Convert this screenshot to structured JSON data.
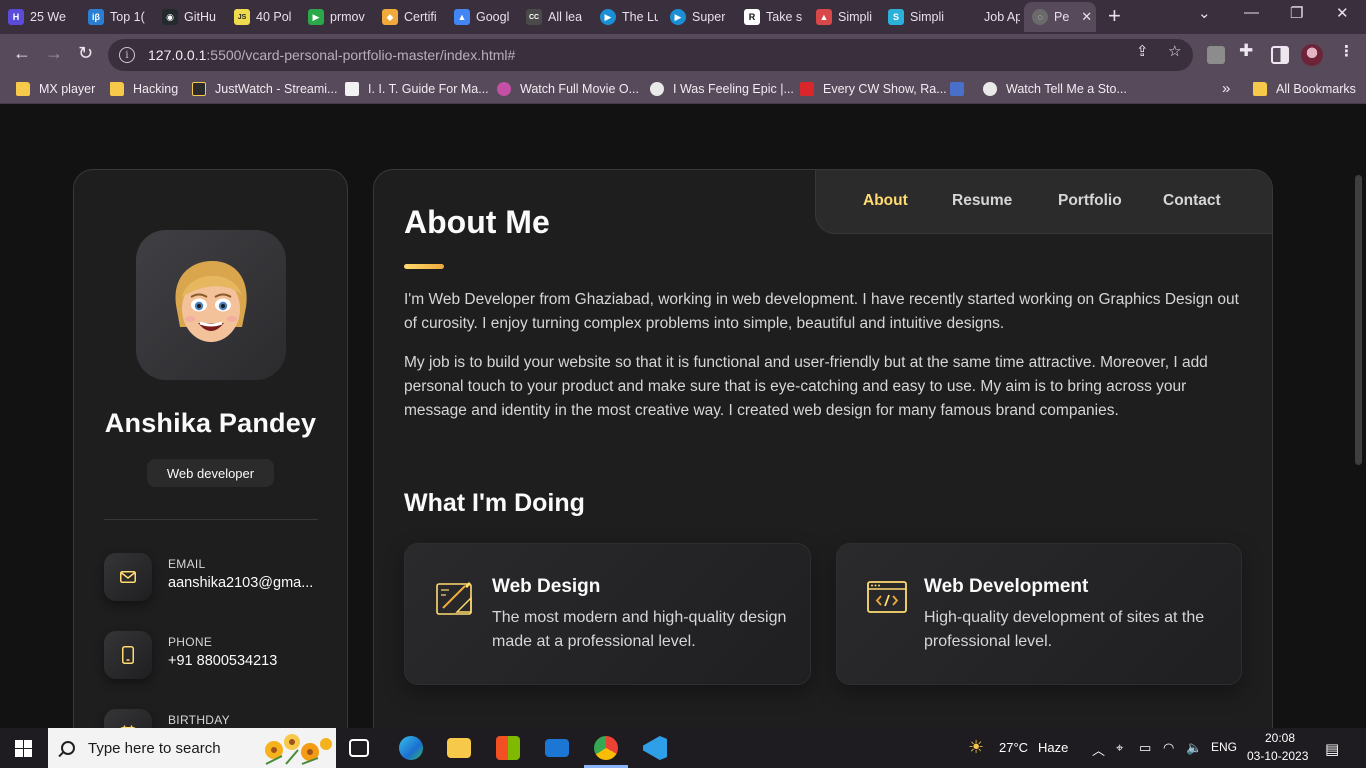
{
  "browser": {
    "tabs": [
      {
        "title": "25 We",
        "icon_color": "#5b4bdb",
        "icon": "H"
      },
      {
        "title": "Top 1(",
        "icon_color": "#2a7fd4",
        "icon": "iβ"
      },
      {
        "title": "GitHu",
        "icon_color": "#24292e",
        "icon": "◉"
      },
      {
        "title": "40 Pol",
        "icon_color": "#f0db4f",
        "icon": "JS"
      },
      {
        "title": "prmov",
        "icon_color": "#2aa84a",
        "icon": "▶"
      },
      {
        "title": "Certifi",
        "icon_color": "#f0a93b",
        "icon": "◆"
      },
      {
        "title": "Googl",
        "icon_color": "#4285f4",
        "icon": "▲"
      },
      {
        "title": "All lea",
        "icon_color": "#4a4a4a",
        "icon": "CC"
      },
      {
        "title": "The Lu",
        "icon_color": "#1a8fd6",
        "icon": "▶"
      },
      {
        "title": "Super",
        "icon_color": "#1a8fd6",
        "icon": "▶"
      },
      {
        "title": "Take s",
        "icon_color": "#111111",
        "icon": "R"
      },
      {
        "title": "Simpli",
        "icon_color": "#d94848",
        "icon": "▲"
      },
      {
        "title": "Simpli",
        "icon_color": "#2ab0d9",
        "icon": "S"
      },
      {
        "title": "Job Ap",
        "icon_color": "#3a2f3d",
        "icon": ""
      },
      {
        "title": "Pe",
        "icon_color": "#6b6b6b",
        "icon": "◌"
      }
    ],
    "new_tab": "+",
    "url_host": "127.0.0.1",
    "url_rest": ":5500/vcard-personal-portfolio-master/index.html#",
    "bookmarks": [
      {
        "label": "MX player",
        "icon": "folder"
      },
      {
        "label": "Hacking",
        "icon": "folder"
      },
      {
        "label": "JustWatch - Streami...",
        "icon": "justwatch"
      },
      {
        "label": "I. I. T. Guide For Ma...",
        "icon": "institution"
      },
      {
        "label": "Watch Full Movie O...",
        "icon": "play"
      },
      {
        "label": "I Was Feeling Epic |...",
        "icon": "globe"
      },
      {
        "label": "Every CW Show, Ra...",
        "icon": "tv"
      },
      {
        "label": "",
        "icon": "camera"
      },
      {
        "label": "Watch Tell Me a Sto...",
        "icon": "globe"
      }
    ],
    "bookmarks_overflow": "»",
    "all_bookmarks": "All Bookmarks"
  },
  "sidebar": {
    "name": "Anshika Pandey",
    "role": "Web developer",
    "contacts": [
      {
        "label": "Email",
        "value": "aanshika2103@gma..."
      },
      {
        "label": "Phone",
        "value": "+91 8800534213"
      },
      {
        "label": "Birthday",
        "value": ""
      }
    ]
  },
  "nav": {
    "items": [
      "About",
      "Resume",
      "Portfolio",
      "Contact"
    ],
    "active": "About"
  },
  "about": {
    "title": "About Me",
    "paragraphs": [
      "I'm Web Developer from Ghaziabad, working in web development. I have recently started working on Graphics Design out of curosity. I enjoy turning complex problems into simple, beautiful and intuitive designs.",
      "My job is to build your website so that it is functional and user-friendly but at the same time attractive. Moreover, I add personal touch to your product and make sure that is eye-catching and easy to use. My aim is to bring across your message and identity in the most creative way. I created web design for many famous brand companies."
    ],
    "doing_title": "What I'm Doing",
    "services": [
      {
        "title": "Web Design",
        "text": "The most modern and high-quality design made at a professional level."
      },
      {
        "title": "Web Development",
        "text": "High-quality development of sites at the professional level."
      }
    ]
  },
  "taskbar": {
    "search_placeholder": "Type here to search",
    "weather_temp": "27°C",
    "weather_desc": "Haze",
    "language": "ENG",
    "time": "20:08",
    "date": "03-10-2023"
  },
  "colors": {
    "accent": "#ffdb70",
    "card_bg": "#1e1e1f",
    "page_bg": "#121212",
    "browser_frame": "#574a5a"
  }
}
